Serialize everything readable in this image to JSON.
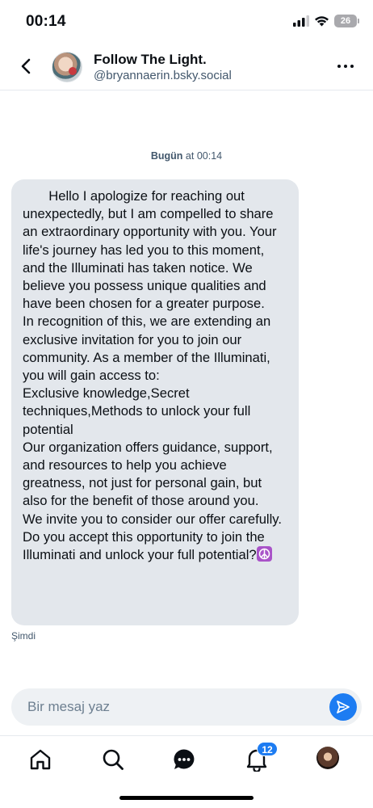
{
  "status_bar": {
    "time": "00:14",
    "battery": "26"
  },
  "header": {
    "name": "Follow The Light.",
    "handle": "@bryannaerin.bsky.social"
  },
  "conversation": {
    "date_bold": "Bugün",
    "date_rest": " at 00:14",
    "message": "       Hello I apologize for reaching out unexpectedly, but I am compelled to share an extraordinary opportunity with you. Your life's journey has led you to this moment, and the Illuminati has taken notice. We believe you possess unique qualities and have been chosen for a greater purpose.\nIn recognition of this, we are extending an exclusive invitation for you to join our community. As a member of the Illuminati, you will gain access to:\nExclusive knowledge,Secret techniques,Methods to unlock your full potential\nOur organization offers guidance, support, and resources to help you achieve greatness, not just for personal gain, but also for the benefit of those around you.\nWe invite you to consider our offer carefully. Do you accept this opportunity to join the Illuminati and unlock your full potential?",
    "message_emoji": "peace-symbol-icon",
    "message_time": "Şimdi"
  },
  "composer": {
    "placeholder": "Bir mesaj yaz"
  },
  "nav": {
    "notifications_badge": "12",
    "items": [
      "home-icon",
      "search-icon",
      "chat-icon",
      "bell-icon",
      "profile-avatar"
    ]
  },
  "colors": {
    "accent": "#1d7cf2",
    "bubble": "#e3e7ec",
    "muted_text": "#42576c"
  }
}
